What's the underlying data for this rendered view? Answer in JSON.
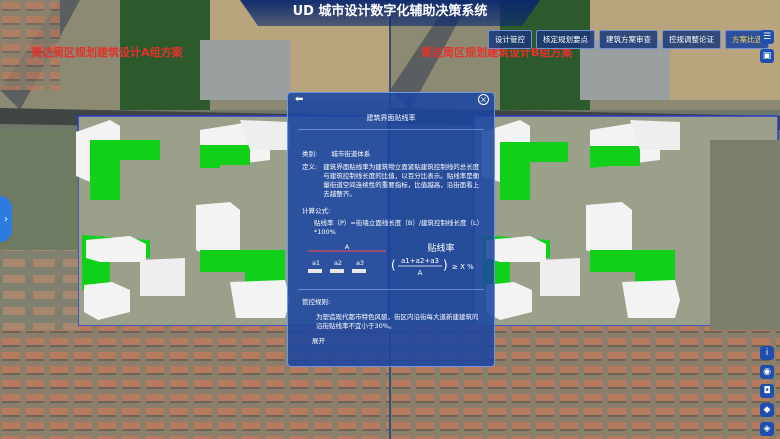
{
  "app": {
    "title": "UD 城市设计数字化辅助决策系统"
  },
  "left_scheme": {
    "label": "黄达周区规划建筑设计A组方案"
  },
  "right_scheme": {
    "label": "黄达周区规划建筑设计B组方案"
  },
  "toolbar": {
    "buttons": [
      {
        "label": "设计管控"
      },
      {
        "label": "核定规划要点"
      },
      {
        "label": "建筑方案审查"
      },
      {
        "label": "控规调整论证"
      },
      {
        "label": "方案比选"
      }
    ]
  },
  "panel": {
    "title": "建筑界面贴线率",
    "category_label": "类别:",
    "category_value": "城市街道体系",
    "definition_label": "定义:",
    "definition_text": "建筑界面贴线率为建筑物立面紧贴建筑控制线的总长度与建筑控制线长度的比值，以百分比表示。贴线率是衡量街道空间连续性的重要指标，比值越高，沿街面看上去越整齐。",
    "formula_label": "计算公式:",
    "formula_line1": "贴线率（P）=街墙立面线长度（B）/建筑控制线长度（L）*100%",
    "formula_var": "A",
    "formula_parts": [
      "a1",
      "a2",
      "a3"
    ],
    "formula_rate_label": "贴线率",
    "formula_numerator": "a1+a2+a3",
    "formula_denominator": "A",
    "formula_condition": "≥ X %",
    "control_label": "管控规则:",
    "control_text": "为塑造现代都市特色风貌，街区内沿街每大道新建建筑的沿街贴线率不宜小于30%。",
    "expand_label": "展开"
  },
  "colors": {
    "building_green": "#0fd21a",
    "panel_bg": "#1c46a0",
    "label_red": "#e5322b"
  },
  "icons": {
    "back": "back-arrow-icon",
    "close": "close-circle-icon"
  }
}
